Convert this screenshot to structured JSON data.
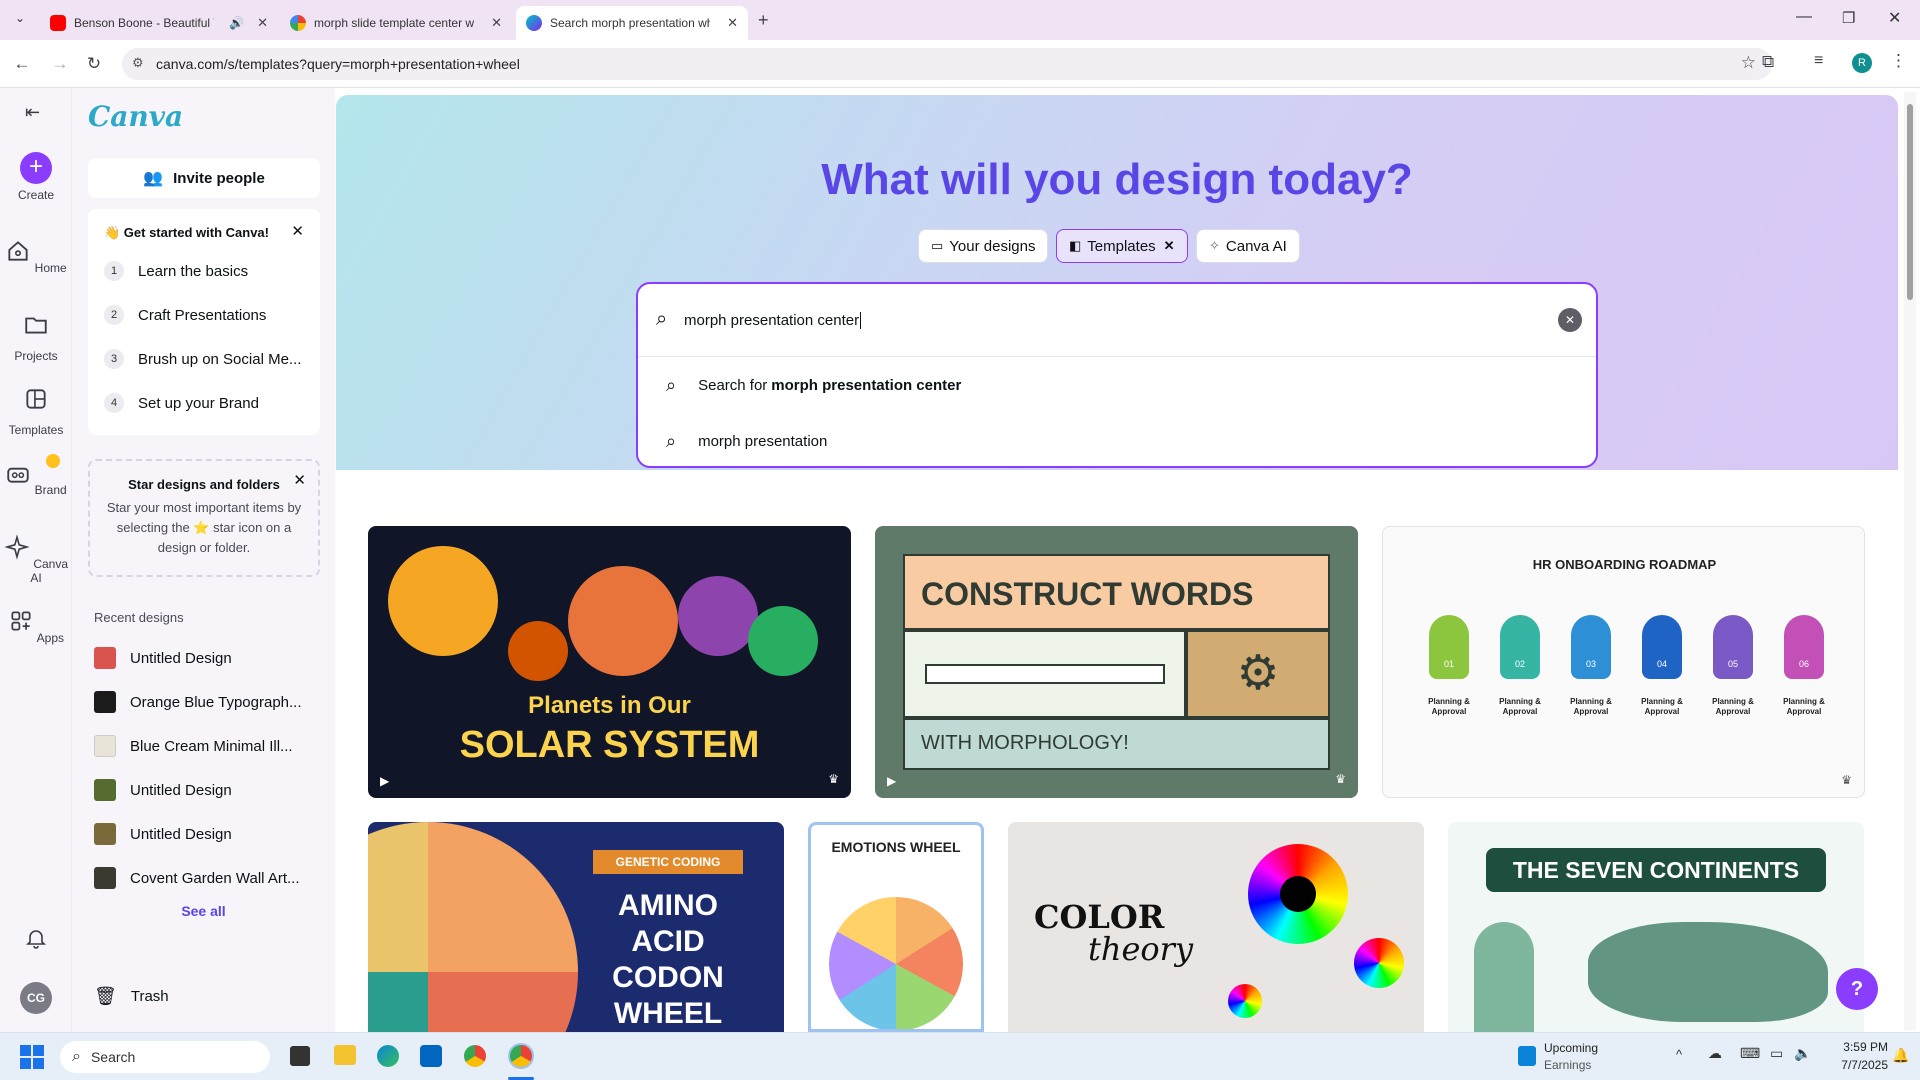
{
  "browser": {
    "tabs": [
      {
        "title": "Benson Boone - Beautiful T",
        "favicon": "youtube-icon",
        "audio": true,
        "active": false
      },
      {
        "title": "morph slide template center w",
        "favicon": "google-icon",
        "active": false
      },
      {
        "title": "Search morph presentation whe",
        "favicon": "canva-icon",
        "active": true
      }
    ],
    "url": "canva.com/s/templates?query=morph+presentation+wheel",
    "profile_initial": "R"
  },
  "rail": {
    "items": [
      {
        "label": "Create",
        "icon": "plus-icon"
      },
      {
        "label": "Home",
        "icon": "home-icon"
      },
      {
        "label": "Projects",
        "icon": "folder-icon"
      },
      {
        "label": "Templates",
        "icon": "templates-icon"
      },
      {
        "label": "Brand",
        "icon": "brand-icon"
      },
      {
        "label": "Canva AI",
        "icon": "sparkle-icon"
      },
      {
        "label": "Apps",
        "icon": "apps-icon"
      }
    ],
    "avatar_initials": "CG"
  },
  "panel": {
    "logo": "Canva",
    "invite_label": "Invite people",
    "get_started": {
      "title": "👋 Get started with Canva!",
      "steps": [
        {
          "num": "1",
          "label": "Learn the basics"
        },
        {
          "num": "2",
          "label": "Craft Presentations"
        },
        {
          "num": "3",
          "label": "Brush up on Social Me..."
        },
        {
          "num": "4",
          "label": "Set up your Brand"
        }
      ]
    },
    "star_tip": {
      "title": "Star designs and folders",
      "body": "Star your most important items by selecting the ⭐ star icon on a design or folder."
    },
    "recent_title": "Recent designs",
    "recent": [
      {
        "label": "Untitled Design",
        "color": "#d9534f"
      },
      {
        "label": "Orange Blue Typograph...",
        "color": "#1b1b1b"
      },
      {
        "label": "Blue Cream Minimal Ill...",
        "color": "#e8e4d8"
      },
      {
        "label": "Untitled Design",
        "color": "#556b2f"
      },
      {
        "label": "Untitled Design",
        "color": "#7a6a3a"
      },
      {
        "label": "Covent Garden Wall Art...",
        "color": "#3b3a30"
      }
    ],
    "see_all": "See all",
    "trash": "Trash"
  },
  "main": {
    "heading": "What will you design today?",
    "pills": [
      {
        "label": "Your designs",
        "icon": "folder-icon"
      },
      {
        "label": "Templates",
        "icon": "templates-icon",
        "active": true
      },
      {
        "label": "Canva AI",
        "icon": "sparkle-icon"
      }
    ],
    "search": {
      "value": "morph presentation center",
      "suggestions": [
        {
          "prefix": "Search for ",
          "bold": "morph presentation center"
        },
        {
          "prefix": "morph presentation",
          "bold": ""
        }
      ]
    },
    "templates_row1": [
      {
        "line1": "Planets in Our",
        "line2": "SOLAR SYSTEM"
      },
      {
        "line1": "CONSTRUCT WORDS",
        "line2": "WITH MORPHOLOGY!"
      },
      {
        "title": "HR ONBOARDING ROADMAP",
        "steps": [
          "01",
          "02",
          "03",
          "04",
          "05",
          "06"
        ],
        "step_title": "Planning & Approval"
      }
    ],
    "templates_row2": [
      {
        "badge": "GENETIC CODING",
        "title": "AMINO ACID CODON WHEEL"
      },
      {
        "title": "EMOTIONS WHEEL"
      },
      {
        "line1": "COLOR",
        "line2": "theory"
      },
      {
        "title": "THE SEVEN CONTINENTS"
      }
    ]
  },
  "taskbar": {
    "search_placeholder": "Search",
    "widget_title": "Upcoming",
    "widget_sub": "Earnings",
    "time": "3:59 PM",
    "date": "7/7/2025"
  }
}
